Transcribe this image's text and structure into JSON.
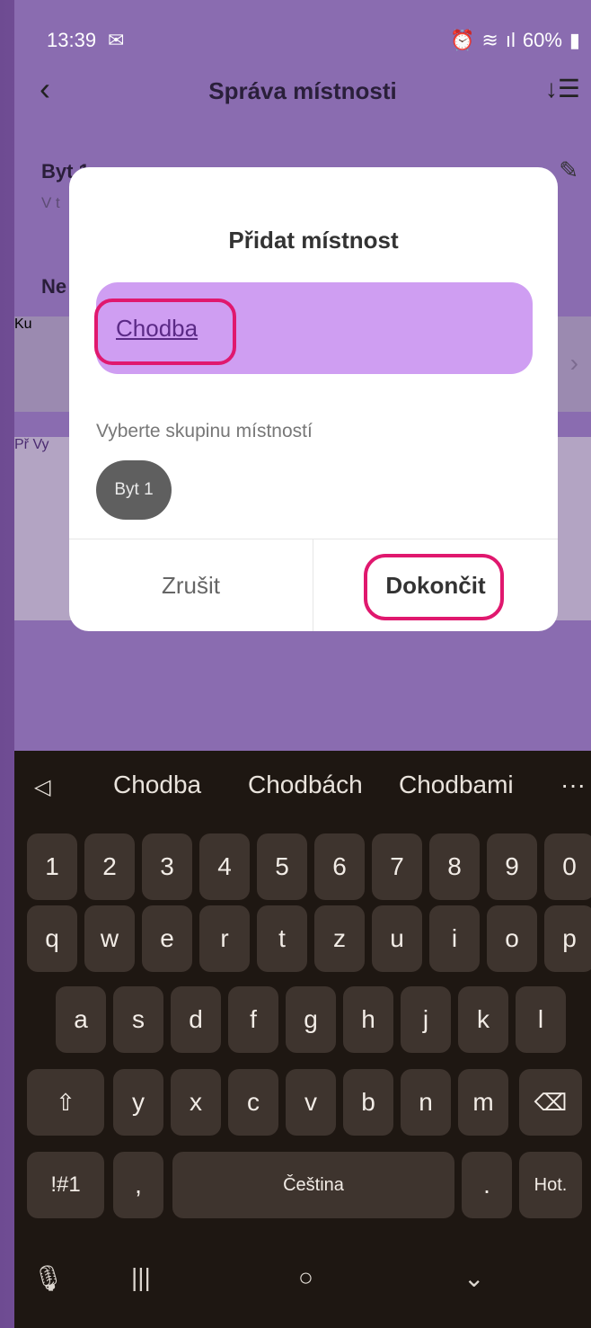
{
  "status_bar": {
    "time": "13:39",
    "mail_icon": "mail-icon",
    "battery": "60%"
  },
  "app": {
    "title": "Správa místnosti",
    "back_icon": "chevron-left-icon",
    "sort_icon": "sort-icon",
    "edit_icon": "pencil-icon",
    "row1_label": "Byt 1",
    "row1_sub": "V t",
    "row2_label": "Ne",
    "row3_label": "Ku",
    "row4_label": "Př",
    "row5_label": "Vy"
  },
  "dialog": {
    "title": "Přidat místnost",
    "input_value": "Chodba",
    "group_label": "Vyberte skupinu místností",
    "chip_label": "Byt 1",
    "cancel_label": "Zrušit",
    "done_label": "Dokončit",
    "highlight_color": "#e0186e"
  },
  "keyboard": {
    "suggestions": [
      "Chodba",
      "Chodbách",
      "Chodbami"
    ],
    "more": "···",
    "row_numbers": [
      "1",
      "2",
      "3",
      "4",
      "5",
      "6",
      "7",
      "8",
      "9",
      "0"
    ],
    "row_q": [
      "q",
      "w",
      "e",
      "r",
      "t",
      "z",
      "u",
      "i",
      "o",
      "p"
    ],
    "row_a": [
      "a",
      "s",
      "d",
      "f",
      "g",
      "h",
      "j",
      "k",
      "l"
    ],
    "row_y": [
      "y",
      "x",
      "c",
      "v",
      "b",
      "n",
      "m"
    ],
    "shift": "⇧",
    "backspace": "⌫",
    "symbols": "!#1",
    "comma": ",",
    "space": "Čeština",
    "period": ".",
    "action": "Hot."
  }
}
